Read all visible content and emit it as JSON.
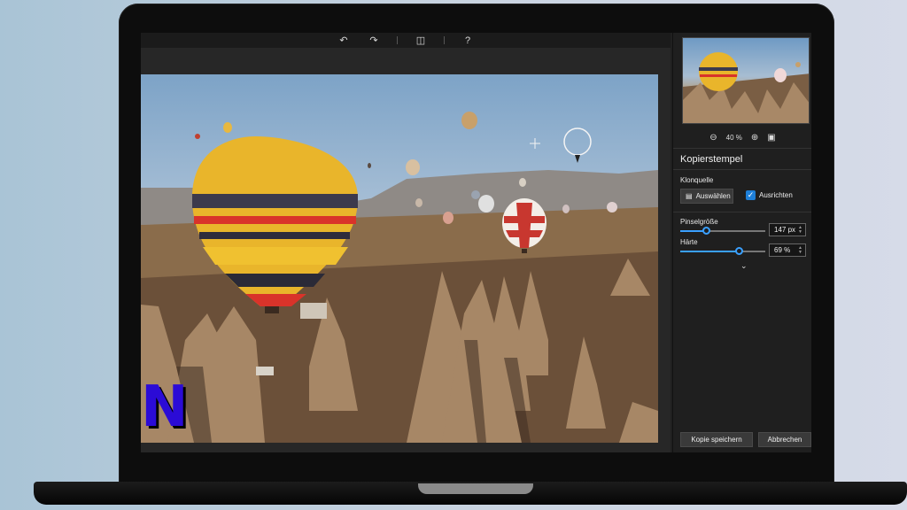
{
  "toolbar": {
    "undo_icon": "undo-icon",
    "redo_icon": "redo-icon",
    "compare_icon": "compare-icon",
    "help_label": "?"
  },
  "panel": {
    "zoom": {
      "value": "40 %"
    },
    "tool_title": "Kopierstempel",
    "clone_source_label": "Klonquelle",
    "select_button": "Auswählen",
    "align_label": "Ausrichten",
    "align_checked": true,
    "brush_size_label": "Pinselgröße",
    "brush_size_value": "147 px",
    "brush_size_fraction": 0.3,
    "hardness_label": "Härte",
    "hardness_value": "69 %",
    "hardness_fraction": 0.69,
    "save_copy_button": "Kopie speichern",
    "cancel_button": "Abbrechen"
  },
  "colors": {
    "accent": "#3aa0ff",
    "panel_bg": "#1f1f1f",
    "brand_logo": "#2b0bd6"
  },
  "brand": {
    "logo_letter": "N"
  }
}
